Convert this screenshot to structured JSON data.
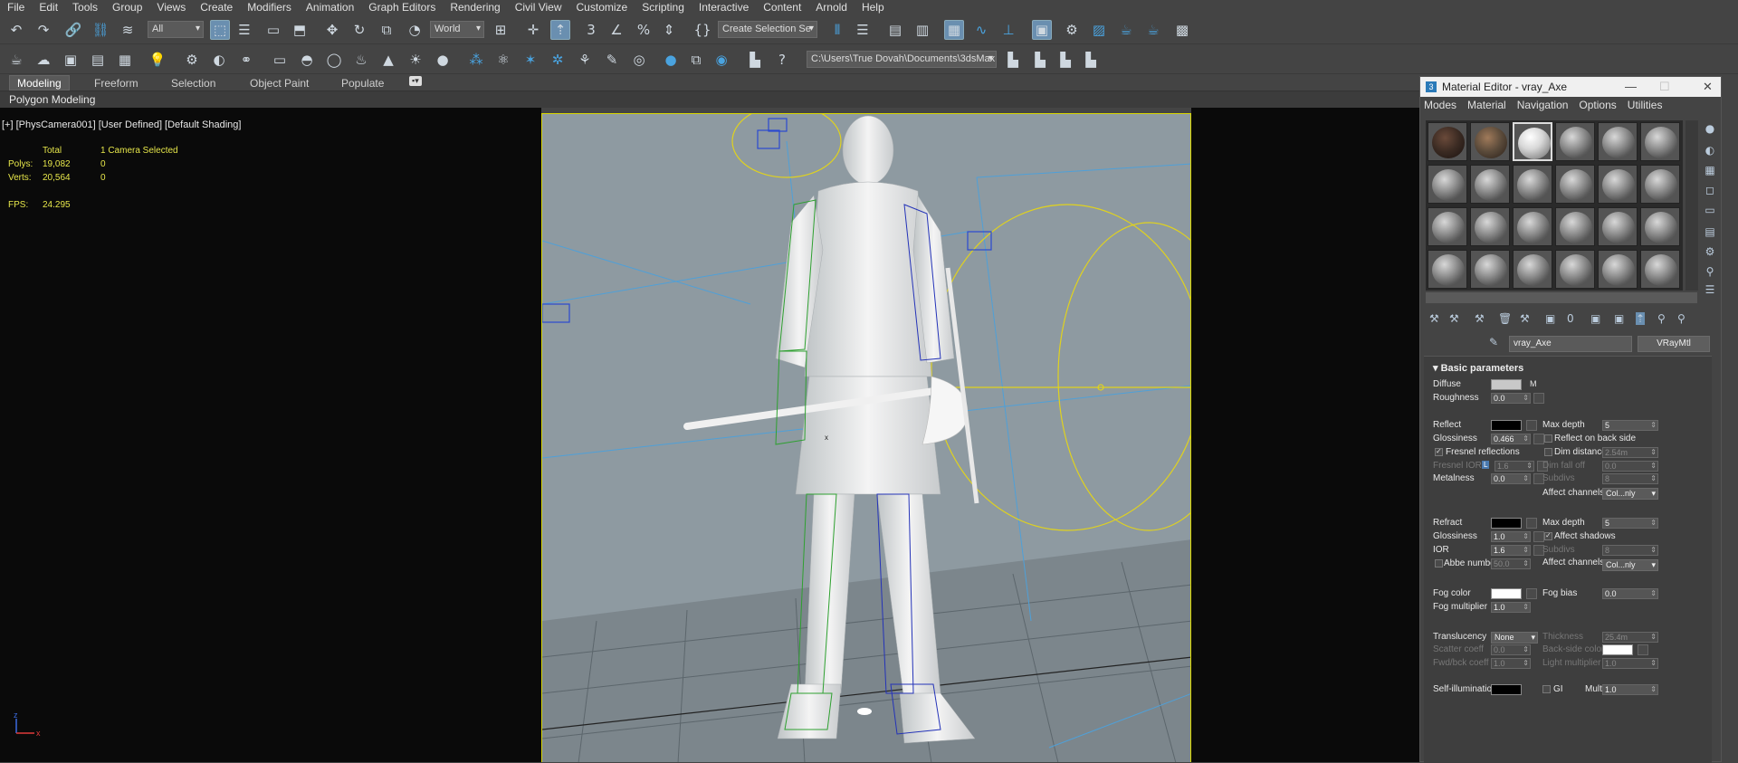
{
  "menu": [
    "File",
    "Edit",
    "Tools",
    "Group",
    "Views",
    "Create",
    "Modifiers",
    "Animation",
    "Graph Editors",
    "Rendering",
    "Civil View",
    "Customize",
    "Scripting",
    "Interactive",
    "Content",
    "Arnold",
    "Help"
  ],
  "toolbar": {
    "filter_value": "All",
    "coord_value": "World",
    "selection_set_placeholder": "Create Selection Se",
    "project_path": "C:\\Users\\True Dovah\\Documents\\3dsMax"
  },
  "ribbon": {
    "tabs": [
      "Modeling",
      "Freeform",
      "Selection",
      "Object Paint",
      "Populate"
    ],
    "panel": "Polygon Modeling"
  },
  "viewport": {
    "label": "[+] [PhysCamera001] [User Defined] [Default Shading]",
    "stats": {
      "total_label": "Total",
      "selected_label": "1 Camera Selected",
      "polys_label": "Polys:",
      "polys_total": "19,082",
      "polys_selected": "0",
      "verts_label": "Verts:",
      "verts_total": "20,564",
      "verts_selected": "0",
      "fps_label": "FPS:",
      "fps_value": "24.295"
    },
    "gizmo_x": "x",
    "axis_z": "z",
    "axis_x": "x"
  },
  "material_editor": {
    "title": "Material Editor - vray_Axe",
    "logo": "3",
    "menu": [
      "Modes",
      "Material",
      "Navigation",
      "Options",
      "Utilities"
    ],
    "material_name": "vray_Axe",
    "material_type": "VRayMtl",
    "section_title": "Basic parameters",
    "diffuse": {
      "label": "Diffuse",
      "map_btn": "M",
      "color": "#c8c8c8"
    },
    "roughness": {
      "label": "Roughness",
      "value": "0.0"
    },
    "reflect": {
      "label": "Reflect",
      "color": "#000000"
    },
    "glossiness": {
      "label": "Glossiness",
      "value": "0.466"
    },
    "fresnel": {
      "label": "Fresnel reflections"
    },
    "fresnel_ior": {
      "label": "Fresnel IOR",
      "lock": "L",
      "value": "1.6"
    },
    "metalness": {
      "label": "Metalness",
      "value": "0.0"
    },
    "max_depth": {
      "label": "Max depth",
      "value": "5"
    },
    "reflect_back": {
      "label": "Reflect on back side"
    },
    "dim_distance": {
      "label": "Dim distance",
      "value": "2.54m"
    },
    "dim_falloff": {
      "label": "Dim fall off",
      "value": "0.0"
    },
    "subdivs": {
      "label": "Subdivs",
      "value": "8"
    },
    "affect_channels": {
      "label": "Affect channels",
      "value": "Col...nly"
    },
    "refract": {
      "label": "Refract",
      "color": "#000000"
    },
    "refr_glossiness": {
      "label": "Glossiness",
      "value": "1.0"
    },
    "ior": {
      "label": "IOR",
      "value": "1.6"
    },
    "abbe": {
      "label": "Abbe number",
      "value": "50.0"
    },
    "refr_max_depth": {
      "label": "Max depth",
      "value": "5"
    },
    "affect_shadows": {
      "label": "Affect shadows"
    },
    "refr_subdivs": {
      "label": "Subdivs",
      "value": "8"
    },
    "refr_affect_channels": {
      "label": "Affect channels",
      "value": "Col...nly"
    },
    "fog_color": {
      "label": "Fog color",
      "color": "#ffffff"
    },
    "fog_multiplier": {
      "label": "Fog multiplier",
      "value": "1.0"
    },
    "fog_bias": {
      "label": "Fog bias",
      "value": "0.0"
    },
    "translucency": {
      "label": "Translucency",
      "value": "None"
    },
    "scatter": {
      "label": "Scatter coeff",
      "value": "0.0"
    },
    "fwd_bck": {
      "label": "Fwd/bck coeff",
      "value": "1.0"
    },
    "thickness": {
      "label": "Thickness",
      "value": "25.4m"
    },
    "backside_color": {
      "label": "Back-side color",
      "color": "#ffffff"
    },
    "light_mult": {
      "label": "Light multiplier",
      "value": "1.0"
    },
    "self_illum": {
      "label": "Self-illumination"
    },
    "gi_label": "GI",
    "mult_label": "Mult",
    "mult_value": "1.0"
  }
}
